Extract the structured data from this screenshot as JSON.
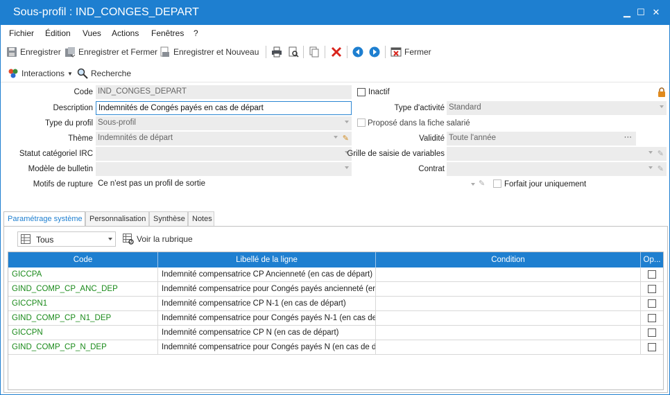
{
  "window": {
    "title": "Sous-profil : IND_CONGES_DEPART",
    "minimize": "▁",
    "maximize": "☐",
    "close": "✕"
  },
  "menu": [
    "Fichier",
    "Édition",
    "Vues",
    "Actions",
    "Fenêtres",
    "?"
  ],
  "toolbar": {
    "save": "Enregistrer",
    "save_close": "Enregistrer et Fermer",
    "save_new": "Enregistrer et Nouveau",
    "close": "Fermer"
  },
  "toolbar2": {
    "interactions": "Interactions",
    "search": "Recherche"
  },
  "form": {
    "code_label": "Code",
    "code_value": "IND_CONGES_DEPART",
    "inactif_label": "Inactif",
    "description_label": "Description",
    "description_value": "Indemnités de Congés payés en cas de départ",
    "type_activite_label": "Type d'activité",
    "type_activite_value": "Standard",
    "type_profil_label": "Type du profil",
    "type_profil_value": "Sous-profil",
    "propose_label": "Proposé dans la fiche salarié",
    "theme_label": "Thème",
    "theme_value": "Indemnités de départ",
    "validite_label": "Validité",
    "validite_value": "Toute l'année",
    "validite_more": "···",
    "statut_label": "Statut catégoriel IRC",
    "statut_value": "",
    "grille_label": "Grille de saisie de variables",
    "grille_value": "",
    "modele_label": "Modèle de bulletin",
    "modele_value": "",
    "contrat_label": "Contrat",
    "contrat_value": "",
    "motifs_label": "Motifs de rupture",
    "motifs_value": "Ce n'est pas un profil de sortie",
    "forfait_label": "Forfait jour uniquement"
  },
  "tabs": [
    "Paramétrage système",
    "Personnalisation",
    "Synthèse",
    "Notes"
  ],
  "filter": {
    "value": "Tous",
    "voir_label": "Voir la rubrique"
  },
  "grid": {
    "headers": [
      "Code",
      "Libellé de la ligne",
      "Condition",
      "Op..."
    ],
    "rows": [
      {
        "code": "GICCPA",
        "label": "Indemnité compensatrice CP Ancienneté (en cas de départ)",
        "condition": ""
      },
      {
        "code": "GIND_COMP_CP_ANC_DEP",
        "label": "Indemnité compensatrice pour Congés payés ancienneté (en ...",
        "condition": ""
      },
      {
        "code": "GICCPN1",
        "label": "Indemnité compensatrice CP N-1 (en cas de départ)",
        "condition": ""
      },
      {
        "code": "GIND_COMP_CP_N1_DEP",
        "label": "Indemnité compensatrice pour Congés payés N-1 (en cas de ...",
        "condition": ""
      },
      {
        "code": "GICCPN",
        "label": "Indemnité compensatrice CP N (en cas de départ)",
        "condition": ""
      },
      {
        "code": "GIND_COMP_CP_N_DEP",
        "label": "Indemnité compensatrice pour Congés payés N (en cas de dé...",
        "condition": ""
      }
    ]
  },
  "colors": {
    "accent": "#1e7fd0",
    "code_green": "#1a8a1a",
    "delete_red": "#d9241c"
  }
}
